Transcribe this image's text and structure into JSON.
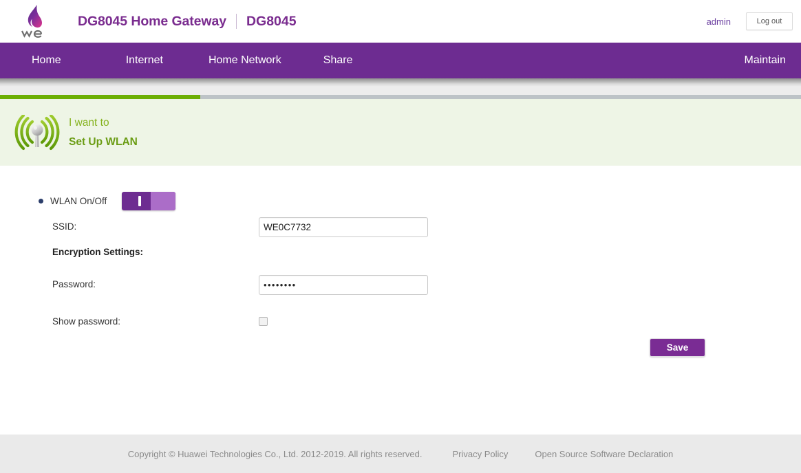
{
  "header": {
    "logo_alt": "we-logo",
    "logo_word": "we",
    "brand_title": "DG8045 Home Gateway",
    "brand_model": "DG8045",
    "user": "admin",
    "logout_label": "Log out"
  },
  "nav": {
    "items": [
      {
        "label": "Home"
      },
      {
        "label": "Internet"
      },
      {
        "label": "Home Network"
      },
      {
        "label": "Share"
      }
    ],
    "right_item": {
      "label": "Maintain"
    }
  },
  "progress": {
    "percent": 25,
    "fill_color": "#6cae05",
    "track_color": "#bdc3c7"
  },
  "banner": {
    "icon": "wifi-antenna-icon",
    "line1": "I want to",
    "line2": "Set Up WLAN",
    "background": "#eef5e6",
    "text_color": "#86b320"
  },
  "form": {
    "wlan_toggle": {
      "label": "WLAN On/Off",
      "state": "on",
      "track_color": "#6d2c91",
      "knob_color": "#ab6dc8"
    },
    "ssid": {
      "label": "SSID:",
      "value": "WE0C7732",
      "placeholder": ""
    },
    "encryption_heading": "Encryption Settings:",
    "password": {
      "label": "Password:",
      "value": "••••••••",
      "placeholder": ""
    },
    "show_password": {
      "label": "Show password:",
      "checked": false
    },
    "save_label": "Save"
  },
  "footer": {
    "copyright": "Copyright © Huawei Technologies Co., Ltd. 2012-2019. All rights reserved.",
    "links": [
      {
        "label": "Privacy Policy"
      },
      {
        "label": "Open Source Software Declaration"
      }
    ]
  },
  "colors": {
    "brand_purple": "#6d2c91",
    "brand_purple_dark": "#7a2c8f",
    "accent_green": "#6cae05",
    "banner_green_text": "#86b320",
    "footer_bg": "#eaeaea"
  }
}
